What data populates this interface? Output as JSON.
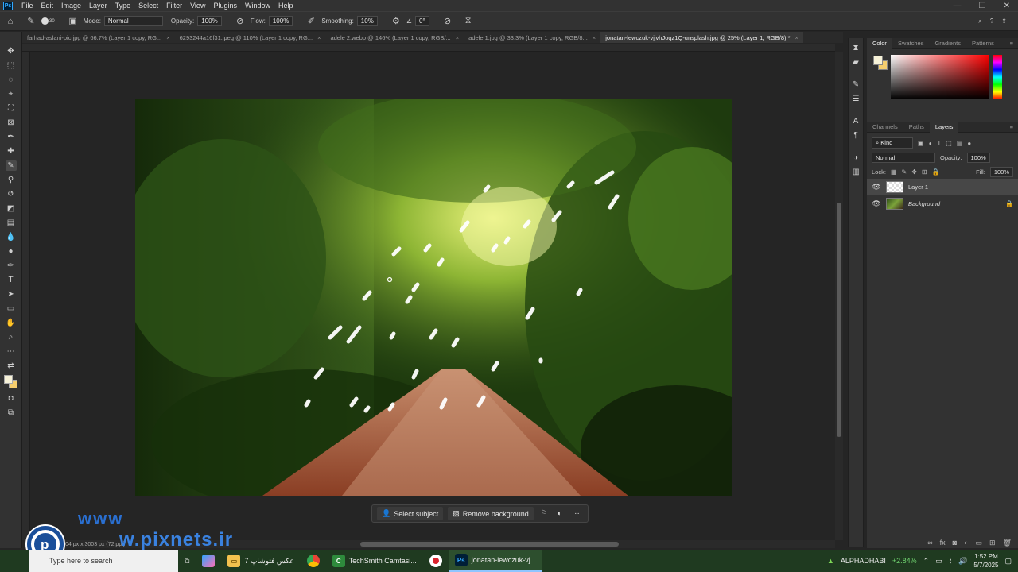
{
  "app": {
    "logo_text": "Ps"
  },
  "menubar": {
    "items": [
      "File",
      "Edit",
      "Image",
      "Layer",
      "Type",
      "Select",
      "Filter",
      "View",
      "Plugins",
      "Window",
      "Help"
    ],
    "controls": [
      "—",
      "❐",
      "✕"
    ]
  },
  "options": {
    "brush_size": "30",
    "mode_label": "Mode:",
    "mode_value": "Normal",
    "opacity_label": "Opacity:",
    "opacity_value": "100%",
    "flow_label": "Flow:",
    "flow_value": "100%",
    "smoothing_label": "Smoothing:",
    "smoothing_value": "10%",
    "angle_value": "0°"
  },
  "tabs": [
    {
      "label": "farhad-aslani-pic.jpg @ 66.7% (Layer 1 copy, RG...",
      "active": false
    },
    {
      "label": "6293244a16f31.jpeg @ 110% (Layer 1 copy, RG...",
      "active": false
    },
    {
      "label": "adele 2.webp @ 146% (Layer 1 copy, RGB/...",
      "active": false
    },
    {
      "label": "adele 1.jpg @ 33.3% (Layer 1 copy, RGB/8...",
      "active": false
    },
    {
      "label": "jonatan-lewczuk-vjjvhJoqz1Q-unsplash.jpg @ 25% (Layer 1, RGB/8) *",
      "active": true
    }
  ],
  "context_bar": {
    "select_subject": "Select subject",
    "remove_background": "Remove background",
    "more": "···"
  },
  "status": {
    "doc_size": "04 px x 3003 px (72 ppi)"
  },
  "panels": {
    "color_tabs": [
      "Color",
      "Swatches",
      "Gradients",
      "Patterns"
    ],
    "layer_tabs": [
      "Channels",
      "Paths",
      "Layers"
    ],
    "filter_kind": "Kind",
    "blend_mode": "Normal",
    "opacity_label": "Opacity:",
    "opacity_value": "100%",
    "lock_label": "Lock:",
    "fill_label": "Fill:",
    "fill_value": "100%",
    "layers": [
      {
        "name": "Layer 1",
        "selected": true
      },
      {
        "name": "Background",
        "selected": false
      }
    ],
    "fg_color": "#f7f2d8",
    "bg_color": "#f5ce6e"
  },
  "watermark": {
    "line1": "www",
    "line2": "w.pixnets.ir"
  },
  "taskbar": {
    "search_placeholder": "Type here to search",
    "items": [
      {
        "label": "عکس فتوشاپ 7",
        "icon": "folder-icon",
        "active": false
      },
      {
        "label": "TechSmith Camtasi...",
        "icon": "camtasia-icon",
        "active": false
      },
      {
        "label": "jonatan-lewczuk-vj...",
        "icon": "photoshop-icon",
        "active": true
      }
    ],
    "stock_name": "ALPHADHABI",
    "stock_change": "+2.84%",
    "time": "1:52 PM",
    "date": "5/7/2025"
  }
}
